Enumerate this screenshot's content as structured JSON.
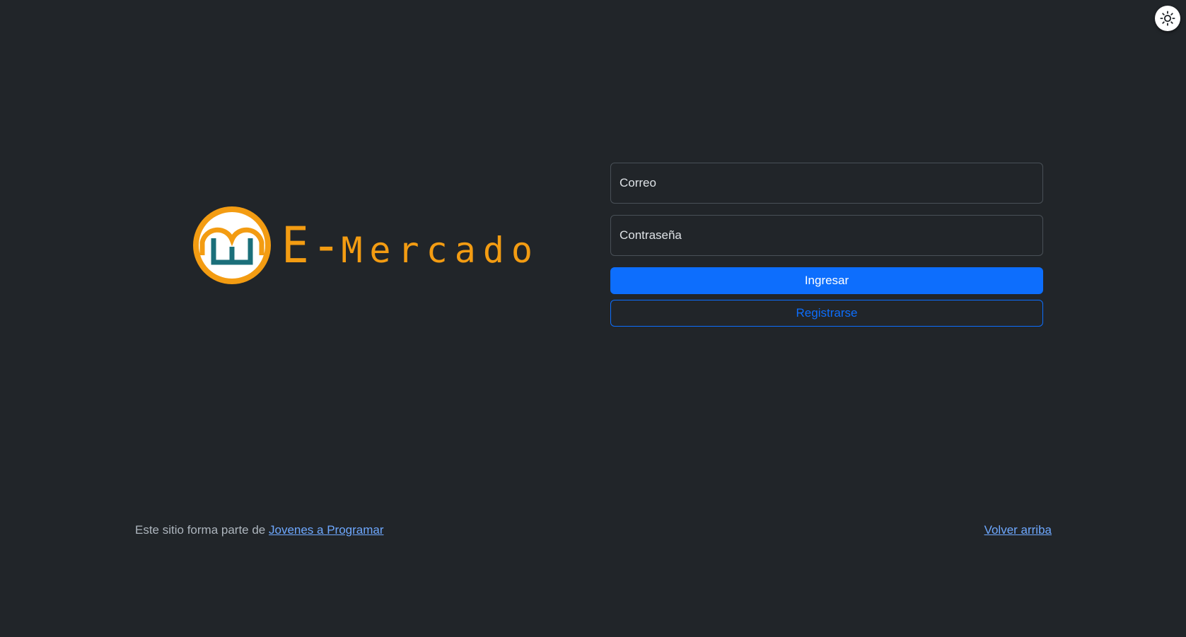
{
  "header": {
    "theme_toggle_icon": "sun-icon"
  },
  "brand": {
    "logo_icon": "e-mercado-logo-icon",
    "name_prefix": "E",
    "name_dash": "-",
    "name_word": "Mercado",
    "color": "#f39c12",
    "accent_color": "#1b6f7a"
  },
  "login_form": {
    "email_placeholder": "Correo",
    "password_placeholder": "Contraseña",
    "submit_label": "Ingresar",
    "register_label": "Registrarse"
  },
  "footer": {
    "text": "Este sitio forma parte de ",
    "link_label": "Jovenes a Programar",
    "back_to_top_label": "Volver arriba"
  },
  "colors": {
    "background": "#212529",
    "primary": "#0d6efd",
    "link": "#6ea8fe"
  }
}
